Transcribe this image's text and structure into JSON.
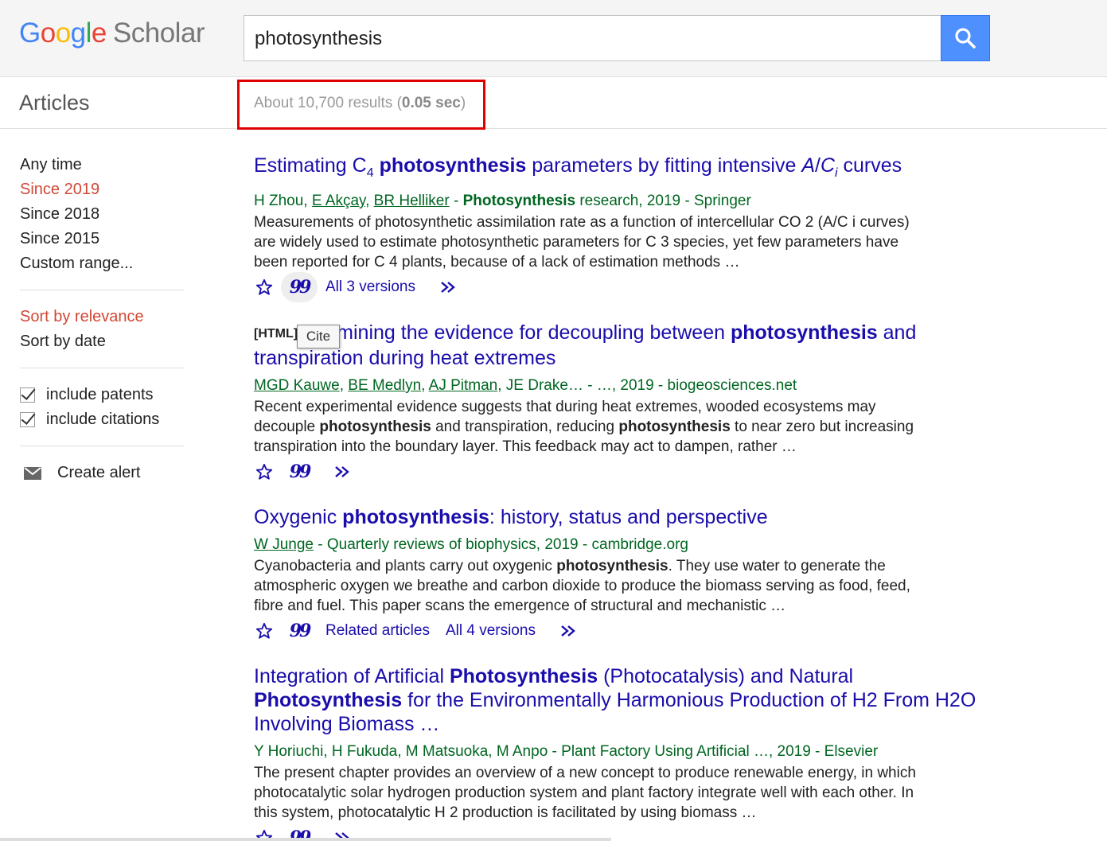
{
  "header": {
    "logo": {
      "letters": [
        "G",
        "o",
        "o",
        "g",
        "l",
        "e"
      ],
      "product": "Scholar"
    },
    "search": {
      "query": "photosynthesis"
    }
  },
  "subbar": {
    "section_label": "Articles",
    "results_prefix": "About 10,700 results (",
    "results_time": "0.05 sec",
    "results_suffix": ")"
  },
  "sidebar": {
    "time_filters": [
      "Any time",
      "Since 2019",
      "Since 2018",
      "Since 2015",
      "Custom range..."
    ],
    "active_time_filter": "Since 2019",
    "sort_options": [
      "Sort by relevance",
      "Sort by date"
    ],
    "active_sort": "Sort by relevance",
    "checkboxes": [
      {
        "label": "include patents",
        "checked": true
      },
      {
        "label": "include citations",
        "checked": true
      }
    ],
    "alert_label": "Create alert"
  },
  "tooltip": {
    "label": "Cite"
  },
  "results": [
    {
      "title_parts": [
        "Estimating C",
        "4",
        " photosynthesis",
        " parameters by fitting intensive ",
        "A",
        "/",
        "C",
        "i",
        " curves"
      ],
      "meta_parts": [
        "H Zhou, ",
        "E Akçay",
        ", ",
        "BR Helliker",
        " - ",
        "Photosynthesis",
        " research, 2019 - Springer"
      ],
      "snippet": "Measurements of photosynthetic assimilation rate as a function of intercellular CO 2 (A/C i curves) are widely used to estimate photosynthetic parameters for C 3 species, yet few parameters have been reported for C 4 plants, because of a lack of estimation methods …",
      "actions": [
        "All 3 versions"
      ]
    },
    {
      "tag": "[HTML]",
      "title_parts": [
        "Examining the evidence for decoupling between ",
        "photosynthesis",
        " and transpiration during heat extremes"
      ],
      "meta_parts": [
        "MGD Kauwe",
        ", ",
        "BE Medlyn",
        ", ",
        "AJ Pitman",
        ", JE Drake… - …, 2019 - biogeosciences.net"
      ],
      "snippet_parts": [
        "Recent experimental evidence suggests that during heat extremes, wooded ecosystems may decouple ",
        "photosynthesis",
        " and transpiration, reducing ",
        "photosynthesis",
        " to near zero but increasing transpiration into the boundary layer. This feedback may act to dampen, rather …"
      ],
      "actions": []
    },
    {
      "title_parts": [
        "Oxygenic ",
        "photosynthesis",
        ": history, status and perspective"
      ],
      "meta_parts": [
        "W Junge",
        " - Quarterly reviews of biophysics, 2019 - cambridge.org"
      ],
      "snippet_parts": [
        "Cyanobacteria and plants carry out oxygenic ",
        "photosynthesis",
        ". They use water to generate the atmospheric oxygen we breathe and carbon dioxide to produce the biomass serving as food, feed, fibre and fuel. This paper scans the emergence of structural and mechanistic …"
      ],
      "actions": [
        "Related articles",
        "All 4 versions"
      ]
    },
    {
      "title_parts": [
        "Integration of Artificial ",
        "Photosynthesis",
        " (Photocatalysis) and Natural ",
        "Photosynthesis",
        " for the Environmentally Harmonious Production of H2 From H2O Involving Biomass …"
      ],
      "meta": "Y Horiuchi, H Fukuda, M Matsuoka, M Anpo - Plant Factory Using Artificial …, 2019 - Elsevier",
      "snippet": "The present chapter provides an overview of a new concept to produce renewable energy, in which photocatalytic solar hydrogen production system and plant factory integrate well with each other. In this system, photocatalytic H 2 production is facilitated by using biomass …",
      "actions": []
    }
  ],
  "icons": {
    "search": "search-icon",
    "save": "star-icon",
    "cite": "quote-icon",
    "more": "double-chevron-icon",
    "alert": "envelope-icon"
  },
  "colors": {
    "link": "#1a0dab",
    "meta": "#006621",
    "active": "#d14836",
    "search_button": "#4d90fe",
    "highlight_box": "#e00000"
  }
}
